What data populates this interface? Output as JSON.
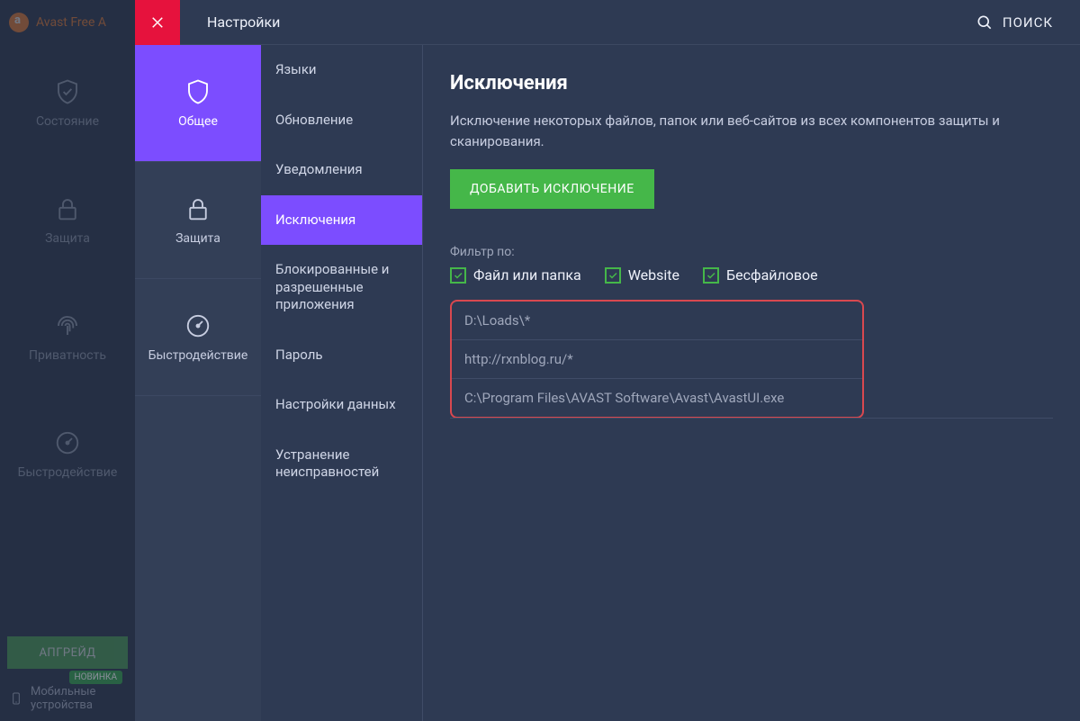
{
  "brand": {
    "name": "Avast Free A"
  },
  "main_nav": {
    "items": [
      {
        "label": "Состояние"
      },
      {
        "label": "Защита"
      },
      {
        "label": "Приватность"
      },
      {
        "label": "Быстродействие"
      }
    ],
    "upgrade_label": "АПГРЕЙД",
    "mobile_badge": "НОВИНКА",
    "mobile_line1": "Мобильные",
    "mobile_line2": "устройства"
  },
  "top_bar": {
    "title": "Настройки",
    "search_label": "ПОИСК"
  },
  "settings_cats": [
    {
      "label": "Общее"
    },
    {
      "label": "Защита"
    },
    {
      "label": "Быстродействие"
    }
  ],
  "submenu": [
    {
      "label": "Языки"
    },
    {
      "label": "Обновление"
    },
    {
      "label": "Уведомления"
    },
    {
      "label": "Исключения"
    },
    {
      "label": "Блокированные и разрешенные приложения"
    },
    {
      "label": "Пароль"
    },
    {
      "label": "Настройки данных"
    },
    {
      "label": "Устранение неисправностей"
    }
  ],
  "content": {
    "heading": "Исключения",
    "description": "Исключение некоторых файлов, папок или веб-сайтов из всех компонентов защиты и сканирования.",
    "add_button": "ДОБАВИТЬ ИСКЛЮЧЕНИЕ",
    "filter_label": "Фильтр по:",
    "filters": [
      {
        "label": "Файл или папка"
      },
      {
        "label": "Website"
      },
      {
        "label": "Бесфайловое"
      }
    ],
    "exclusions": [
      "D:\\Loads\\*",
      "http://rxnblog.ru/*",
      "C:\\Program Files\\AVAST Software\\Avast\\AvastUI.exe"
    ]
  },
  "colors": {
    "accent_purple": "#7c4dff",
    "accent_green": "#45b749",
    "close_red": "#e6123d",
    "highlight_red": "#d9484f"
  }
}
